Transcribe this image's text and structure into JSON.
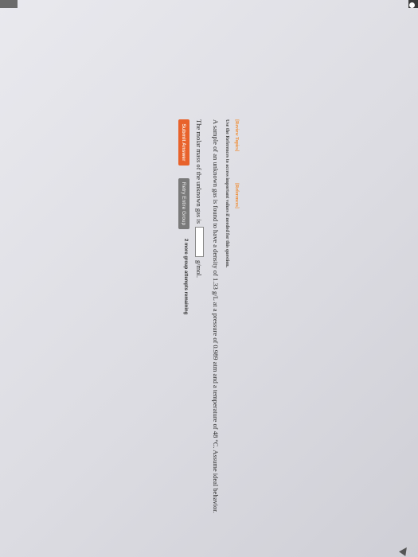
{
  "top_links": {
    "review_topics": "[Review Topics]",
    "references": "[References]"
  },
  "instructions": "Use the References to access important values if needed for this question.",
  "question": "A sample of an unknown gas is found to have a density of 1.33 g/L at a pressure of 0.989 atm and a temperature of 48 °C. Assume ideal behavior.",
  "answer": {
    "prefix": "The molar mass of the unknown gas is",
    "value": "",
    "unit": "g/mol."
  },
  "buttons": {
    "submit": "Submit Answer",
    "retry": "Retry Entire Group"
  },
  "attempts_text": "2 more group attempts remaining",
  "colors": {
    "accent": "#e8622b",
    "secondary_button": "#7a7a7a",
    "link": "#f08a2f"
  }
}
